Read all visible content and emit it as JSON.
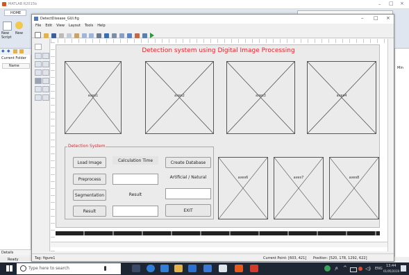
{
  "matlab": {
    "title": "MATLAB R2015b",
    "home_tab": "HOME",
    "new_script": "New\nScript",
    "new": "New",
    "current_folder": "Current Folder",
    "name_col": "Name",
    "min_label": "Min",
    "details": "Details",
    "ready": "Ready"
  },
  "guide": {
    "window_title": "DetectDisease_GUI.fig",
    "menu": [
      "File",
      "Edit",
      "View",
      "Layout",
      "Tools",
      "Help"
    ],
    "tag_label": "Tag: figure1",
    "current_point": "Current Point: [603, 421]",
    "position": "Position: [520, 178, 1292, 622]"
  },
  "figure": {
    "title": "Detection system using Digital Image Processing",
    "axes_top": [
      "axes1",
      "axes2",
      "axes3",
      "axes4"
    ],
    "axes_bottom": [
      "axes6",
      "axes7",
      "axes8"
    ],
    "panel_title": "Detection System",
    "buttons": {
      "load_image": "Load Image",
      "preprocess": "Preprocess",
      "segmentation": "Segmentation",
      "result": "Result",
      "create_database": "Create Database",
      "exit": "EXIT"
    },
    "labels": {
      "calculation_time": "Calculation Time",
      "result": "Result",
      "artificial_natural": "Artificial / Natural"
    },
    "edits": {
      "calc_time_value": "",
      "result_value": "",
      "ann_value": "",
      "result_edit_value": ""
    }
  },
  "taskbar": {
    "search_placeholder": "Type here to search",
    "time": "13:44",
    "date": "01/05/2019",
    "lang": "ENG"
  },
  "colors": {
    "accent_red": "#e8232c",
    "taskbar": "#1f2633",
    "matlab_toolstrip": "#dfe6ef"
  }
}
